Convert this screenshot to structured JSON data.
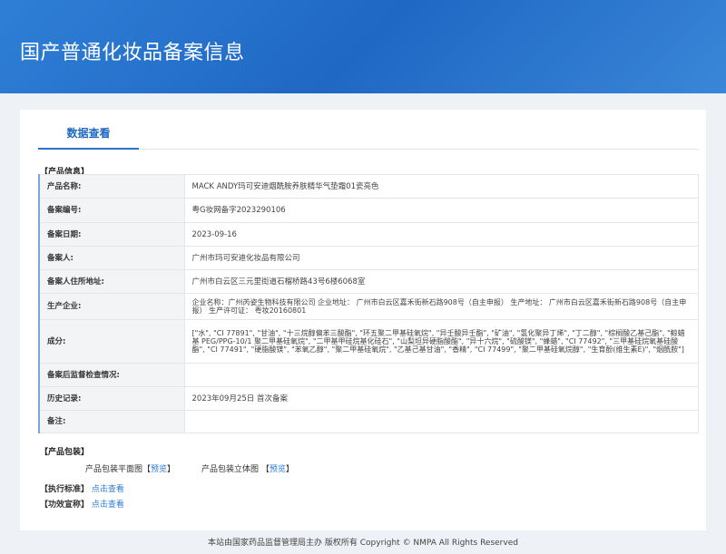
{
  "header": {
    "title": "国产普通化妆品备案信息"
  },
  "tab": "数据查看",
  "sections": {
    "info": "【产品信息】",
    "packaging": "【产品包装】",
    "standard": "【执行标准】",
    "efficacy": "【功效宣称】"
  },
  "rows": [
    {
      "label": "产品名称:",
      "value": "MACK ANDY玛可安迪烟酰胺养肤精华气垫霜01瓷亮色"
    },
    {
      "label": "备案编号:",
      "value": "粤G妆网备字2023290106"
    },
    {
      "label": "备案日期:",
      "value": "2023-09-16"
    },
    {
      "label": "备案人:",
      "value": "广州市玛可安迪化妆品有限公司"
    },
    {
      "label": "备案人住所地址:",
      "value": "广州市白云区三元里街道石榴桥路43号6楼6068室"
    },
    {
      "label": "生产企业:",
      "value": "企业名称：广州芮姿生物科技有限公司 企业地址： 广州市白云区嘉禾街新石路908号（自主申报） 生产地址： 广州市白云区嘉禾街新石路908号（自主申报） 生产许可证： 粤妆20160801"
    },
    {
      "label": "成分:",
      "value": "[\"水\", \"CI 77891\", \"甘油\", \"十三烷醇偏苯三酸酯\", \"环五聚二甲基硅氧烷\", \"异壬酸异壬酯\", \"矿油\", \"氢化聚异丁烯\", \"丁二醇\", \"棕榈酸乙基己酯\", \"鲸蜡基 PEG/PPG-10/1 聚二甲基硅氧烷\", \"二甲基甲硅烷基化硅石\", \"山梨坦异硬脂酸酯\", \"异十六烷\", \"硫酸镁\", \"蜂蜡\", \"CI 77492\", \"三甲基硅烷氧基硅酸酯\", \"CI 77491\", \"硬脂酸镁\", \"苯氧乙醇\", \"聚二甲基硅氧烷\", \"乙基己基甘油\", \"香精\", \"CI 77499\", \"聚二甲基硅氧烷醇\", \"生育酚(维生素E)\", \"烟酰胺\"]"
    },
    {
      "label": "备案后监督检查情况:",
      "value": ""
    },
    {
      "label": "历史记录:",
      "value": "2023年09月25日 首次备案"
    },
    {
      "label": "备注:",
      "value": ""
    }
  ],
  "packaging": {
    "flat_label": "产品包装平面图",
    "stereo_label": "产品包装立体图",
    "preview": "预览",
    "open_bracket": "【",
    "close_bracket": "】"
  },
  "links": {
    "view": "点击查看"
  },
  "footer": "本站由国家药品监督管理局主办 版权所有 Copyright © NMPA All Rights Reserved"
}
